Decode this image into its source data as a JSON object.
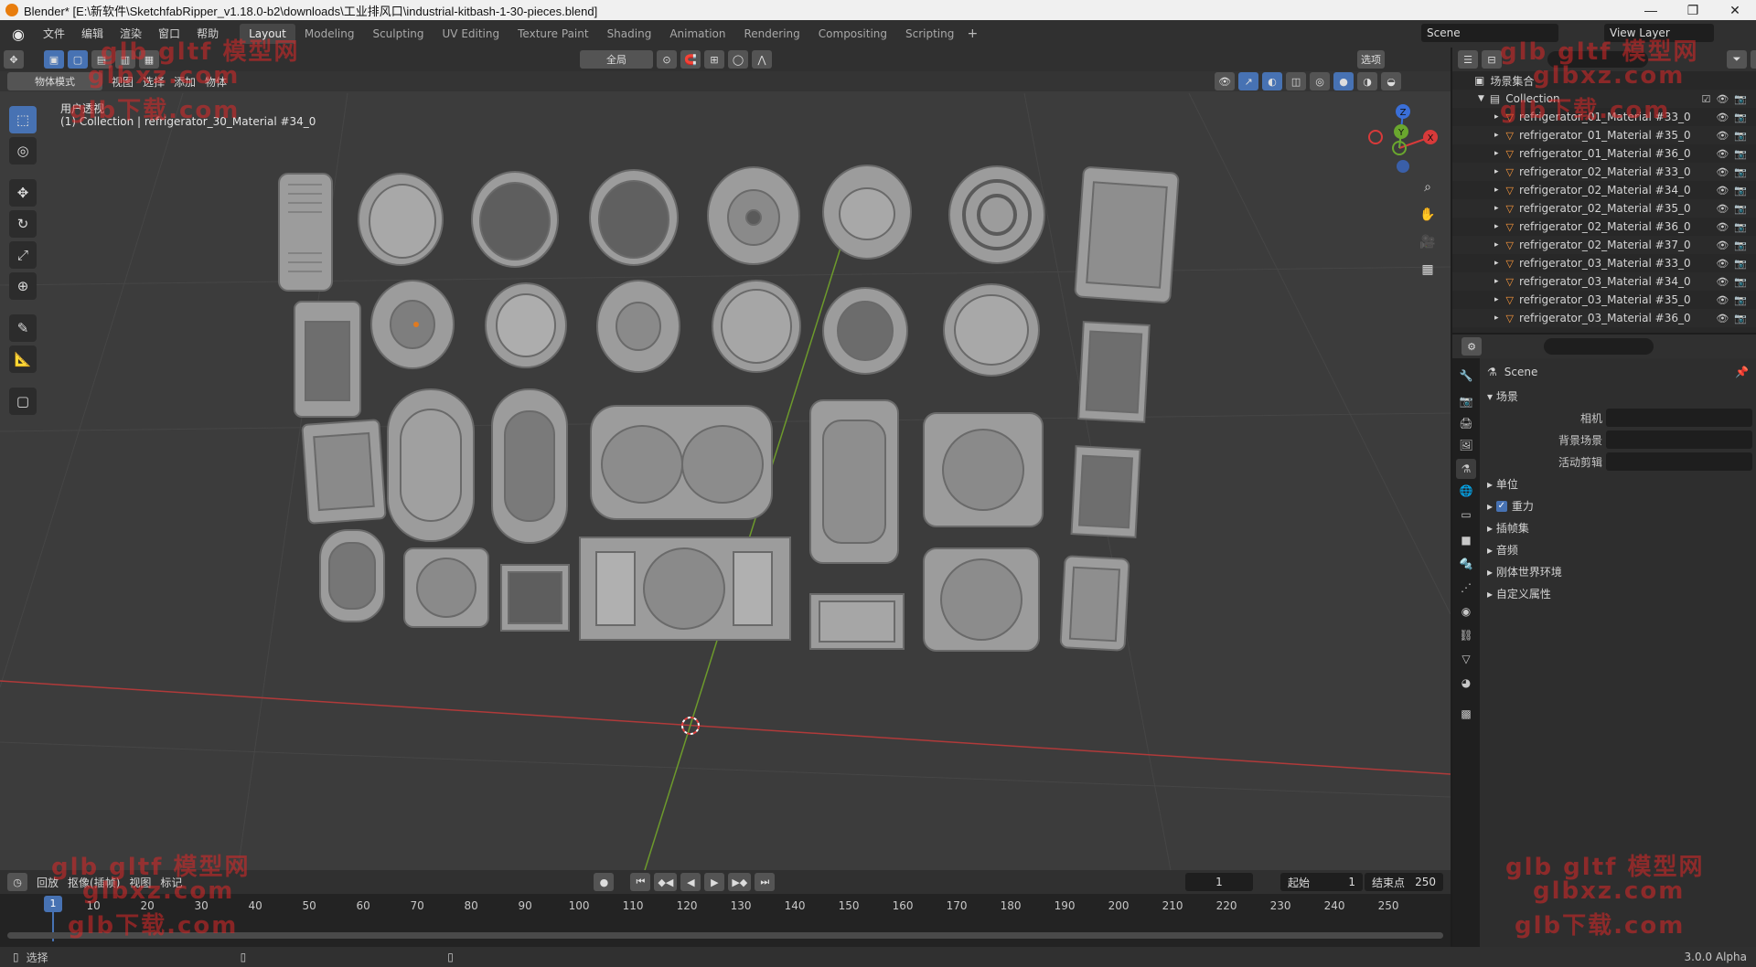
{
  "window": {
    "title": "Blender* [E:\\新软件\\SketchfabRipper_v1.18.0-b2\\downloads\\工业排风口\\industrial-kitbash-1-30-pieces.blend]",
    "controls": [
      "—",
      "❐",
      "✕"
    ]
  },
  "menu": {
    "items": [
      "文件",
      "编辑",
      "渲染",
      "窗口",
      "帮助"
    ]
  },
  "workspaces": {
    "tabs": [
      "Layout",
      "Modeling",
      "Sculpting",
      "UV Editing",
      "Texture Paint",
      "Shading",
      "Animation",
      "Rendering",
      "Compositing",
      "Scripting"
    ],
    "active": "Layout"
  },
  "scene_field": "Scene",
  "view_layer_field": "View Layer",
  "viewport": {
    "transform_orientation": "全局",
    "options_label": "选项",
    "mode": "物体模式",
    "header_menus": [
      "视图",
      "选择",
      "添加",
      "物体"
    ],
    "view_name": "用户透视",
    "collection_info": "(1) Collection | refrigerator_30_Material #34_0",
    "gizmo_axes": [
      "Z",
      "Y",
      "X"
    ]
  },
  "outliner": {
    "root": "场景集合",
    "collection": "Collection",
    "items": [
      "refrigerator_01_Material #33_0",
      "refrigerator_01_Material #35_0",
      "refrigerator_01_Material #36_0",
      "refrigerator_02_Material #33_0",
      "refrigerator_02_Material #34_0",
      "refrigerator_02_Material #35_0",
      "refrigerator_02_Material #36_0",
      "refrigerator_02_Material #37_0",
      "refrigerator_03_Material #33_0",
      "refrigerator_03_Material #34_0",
      "refrigerator_03_Material #35_0",
      "refrigerator_03_Material #36_0"
    ]
  },
  "properties": {
    "context_title": "Scene",
    "section_scene": "场景",
    "camera_label": "相机",
    "background_scene_label": "背景场景",
    "active_clip_label": "活动剪辑",
    "subpanels": [
      "单位",
      "重力",
      "插帧集",
      "音频",
      "刚体世界环境",
      "自定义属性"
    ],
    "gravity_checked": true
  },
  "timeline": {
    "menus": [
      "回放",
      "抠像(插帧)",
      "视图",
      "标记"
    ],
    "current_frame": "1",
    "start_label": "起始",
    "start_value": "1",
    "end_label": "结束点",
    "end_value": "250",
    "ruler_labels": [
      "1",
      "10",
      "20",
      "30",
      "40",
      "50",
      "60",
      "70",
      "80",
      "90",
      "100",
      "110",
      "120",
      "130",
      "140",
      "150",
      "160",
      "170",
      "180",
      "190",
      "200",
      "210",
      "220",
      "230",
      "240",
      "250"
    ]
  },
  "statusbar": {
    "select_label": "选择",
    "version": "3.0.0 Alpha"
  },
  "watermarks": [
    "glb gltf 模型网",
    "glbxz.com",
    "glb下载.com"
  ]
}
